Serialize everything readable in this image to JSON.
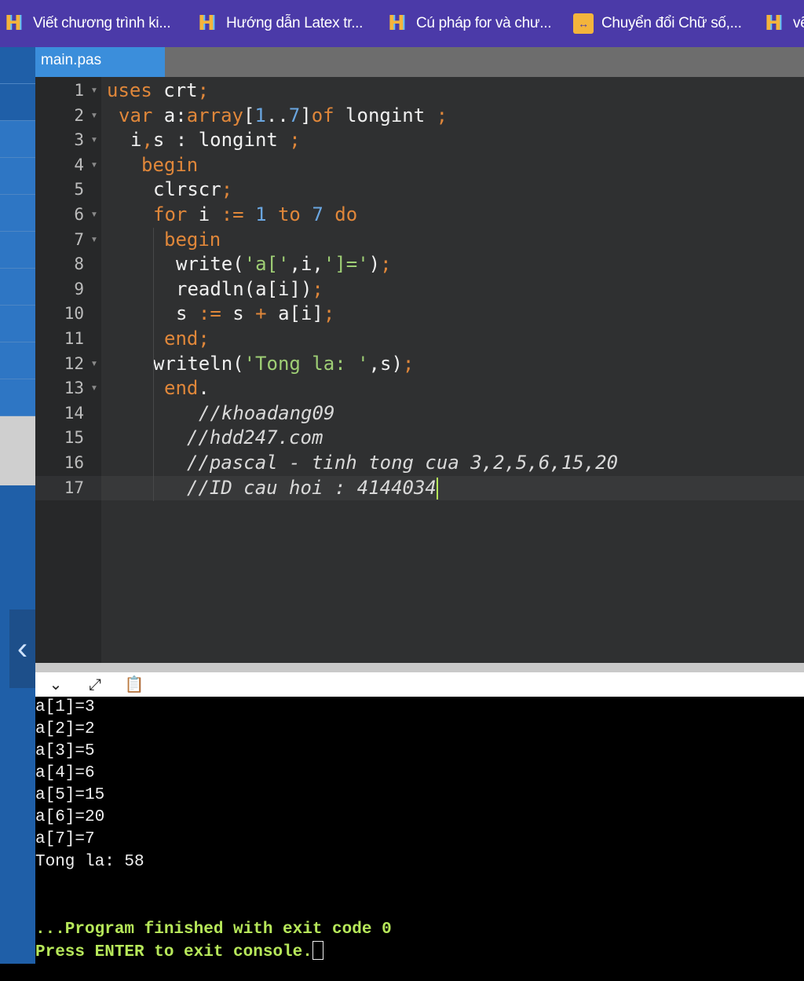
{
  "bookmarks": [
    {
      "label": "Viết chương trình ki...",
      "icon": "hdd-h-icon"
    },
    {
      "label": "Hướng dẫn Latex tr...",
      "icon": "hdd-h-icon"
    },
    {
      "label": "Cú pháp for và chư...",
      "icon": "hdd-h-icon"
    },
    {
      "label": "Chuyển đổi Chữ số,...",
      "icon": "convert-icon"
    },
    {
      "label": "vẽ",
      "icon": "hdd-h-icon"
    }
  ],
  "editor": {
    "tab": "main.pas",
    "line_numbers": [
      "1",
      "2",
      "3",
      "4",
      "5",
      "6",
      "7",
      "8",
      "9",
      "10",
      "11",
      "12",
      "13",
      "14",
      "15",
      "16",
      "17"
    ]
  },
  "console": {
    "lines": [
      "a[1]=3",
      "a[2]=2",
      "a[3]=5",
      "a[4]=6",
      "a[5]=15",
      "a[6]=20",
      "a[7]=7",
      "Tong la: 58"
    ],
    "finished": "...Program finished with exit code 0",
    "prompt": "Press ENTER to exit console."
  }
}
